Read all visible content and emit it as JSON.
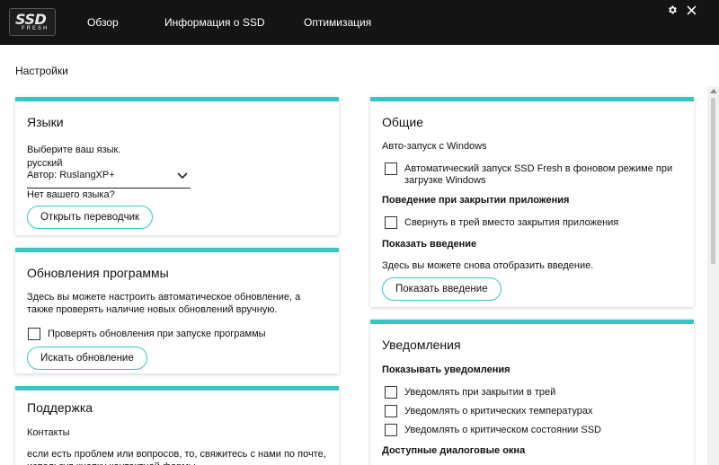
{
  "logo": {
    "main": "SSD",
    "sub": "FRESH"
  },
  "nav": [
    "Обзор",
    "Информация о SSD",
    "Оптимизация"
  ],
  "window_controls": {
    "settings_icon": "gear-icon",
    "close_icon": "close-icon"
  },
  "page_title": "Настройки",
  "languages": {
    "title": "Языки",
    "prompt": "Выберите ваш язык.",
    "selected": {
      "language": "русский",
      "author": "Автор: RuslangXP+"
    },
    "missing": "Нет вашего языка?",
    "button": "Открыть переводчик"
  },
  "updates": {
    "title": "Обновления программы",
    "description": "Здесь вы можете настроить автоматическое обновление, а также проверять наличие новых обновлений вручную.",
    "checkbox": {
      "label": "Проверять обновления при запуске программы",
      "checked": false
    },
    "button": "Искать обновление"
  },
  "support": {
    "title": "Поддержка",
    "contacts_heading": "Контакты",
    "contacts_text": "если есть проблем или вопросов, то, свяжитесь с нами по почте, используя кнопку контактной формы"
  },
  "general": {
    "title": "Общие",
    "autostart_heading": "Авто-запуск с Windows",
    "autostart_checkbox": {
      "label": "Автоматический запуск SSD Fresh в фоновом режиме при загрузке Windows",
      "checked": false
    },
    "close_heading": "Поведение при закрытии приложения",
    "close_checkbox": {
      "label": "Свернуть в трей вместо закрытия приложения",
      "checked": false
    },
    "intro_heading": "Показать введение",
    "intro_text": "Здесь вы можете снова отобразить введение.",
    "intro_button": "Показать введение"
  },
  "notifications": {
    "title": "Уведомления",
    "show_heading": "Показывать уведомления",
    "items": [
      {
        "label": "Уведомлять при закрытии в трей",
        "checked": false
      },
      {
        "label": "Уведомлять о критических температурах",
        "checked": false
      },
      {
        "label": "Уведомлять о критическом состоянии SSD",
        "checked": false
      }
    ],
    "dialogs_heading": "Доступные диалоговые окна"
  },
  "colors": {
    "accent": "#37c6c4",
    "topbar": "#141414"
  }
}
